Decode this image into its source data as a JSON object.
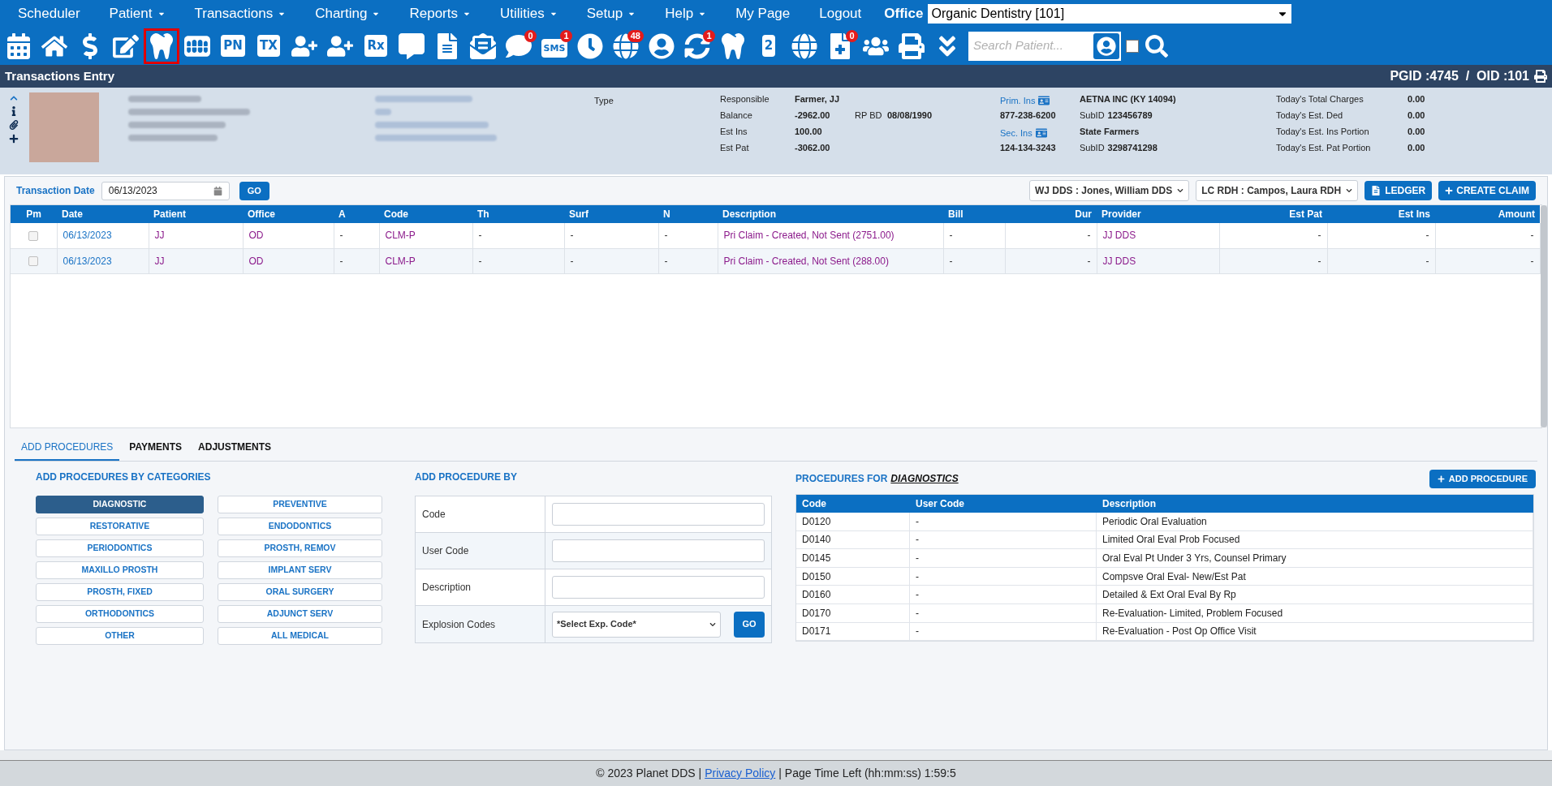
{
  "menu": {
    "items": [
      {
        "label": "Scheduler",
        "has_menu": false
      },
      {
        "label": "Patient",
        "has_menu": true
      },
      {
        "label": "Transactions",
        "has_menu": true
      },
      {
        "label": "Charting",
        "has_menu": true
      },
      {
        "label": "Reports",
        "has_menu": true
      },
      {
        "label": "Utilities",
        "has_menu": true
      },
      {
        "label": "Setup",
        "has_menu": true
      },
      {
        "label": "Help",
        "has_menu": true
      },
      {
        "label": "My Page",
        "has_menu": false
      },
      {
        "label": "Logout",
        "has_menu": false
      }
    ],
    "office_label": "Office",
    "office_value": "Organic Dentistry [101]"
  },
  "toolbar": {
    "items": [
      {
        "selected": false
      },
      {
        "selected": false
      },
      {
        "selected": false
      },
      {
        "selected": false
      },
      {
        "selected": true
      },
      {
        "selected": false
      },
      {
        "selected": false,
        "label": "PN"
      },
      {
        "selected": false,
        "label": "TX"
      },
      {
        "selected": false
      },
      {
        "selected": false
      },
      {
        "selected": false,
        "label": "Rx"
      },
      {
        "selected": false
      },
      {
        "selected": false
      },
      {
        "selected": false
      },
      {
        "selected": false,
        "badge": "0"
      },
      {
        "selected": false,
        "label": "SMS",
        "badge": "1"
      },
      {
        "selected": false
      },
      {
        "selected": false,
        "badge": "48"
      },
      {
        "selected": false
      },
      {
        "selected": false,
        "badge": "1"
      },
      {
        "selected": false
      },
      {
        "selected": false,
        "label": "2"
      },
      {
        "selected": false
      },
      {
        "selected": false,
        "badge": "0"
      },
      {
        "selected": false
      },
      {
        "selected": false
      },
      {
        "selected": false
      }
    ],
    "search_placeholder": "Search Patient...",
    "checkbox_checked": false
  },
  "title_bar": {
    "title": "Transactions Entry",
    "ids": "PGID :4745  /  OID :101"
  },
  "patient": {
    "type_label": "Type",
    "account": [
      {
        "label": "Responsible",
        "value": "Farmer, JJ"
      },
      {
        "label": "Balance",
        "value": "-2962.00"
      },
      {
        "label": "Est Ins",
        "value": "100.00"
      },
      {
        "label": "Est Pat",
        "value": "-3062.00"
      }
    ],
    "rp_bd": {
      "label": "RP BD",
      "value": "08/08/1990"
    },
    "insurance": [
      {
        "label": "Prim. Ins",
        "phone": "877-238-6200",
        "carrier": "AETNA INC (KY 14094)",
        "subid_label": "SubID",
        "subid": "123456789"
      },
      {
        "label": "Sec. Ins",
        "phone": "124-134-3243",
        "carrier": "State Farmers",
        "subid_label": "SubID",
        "subid": "3298741298"
      }
    ],
    "today": [
      {
        "label": "Today's Total Charges",
        "value": "0.00"
      },
      {
        "label": "Today's Est. Ded",
        "value": "0.00"
      },
      {
        "label": "Today's Est. Ins Portion",
        "value": "0.00"
      },
      {
        "label": "Today's Est. Pat Portion",
        "value": "0.00"
      }
    ]
  },
  "transactions": {
    "date_label": "Transaction Date",
    "date_value": "06/13/2023",
    "go": "GO",
    "providers": [
      "WJ DDS : Jones, William DDS",
      "LC RDH : Campos, Laura RDH"
    ],
    "ledger": "LEDGER",
    "create_claim": "CREATE CLAIM",
    "columns": [
      "Pm",
      "Date",
      "Patient",
      "Office",
      "A",
      "Code",
      "Th",
      "Surf",
      "N",
      "Description",
      "Bill",
      "Dur",
      "Provider",
      "Est Pat",
      "Est Ins",
      "Amount"
    ],
    "rows": [
      {
        "checked": false,
        "cells": [
          "",
          "06/13/2023",
          "JJ",
          "OD",
          "-",
          "CLM-P",
          "-",
          "-",
          "-",
          "Pri Claim - Created, Not Sent (2751.00)",
          "-",
          "-",
          "JJ DDS",
          "-",
          "-",
          "-"
        ]
      },
      {
        "checked": false,
        "cells": [
          "",
          "06/13/2023",
          "JJ",
          "OD",
          "-",
          "CLM-P",
          "-",
          "-",
          "-",
          "Pri Claim - Created, Not Sent (288.00)",
          "-",
          "-",
          "JJ DDS",
          "-",
          "-",
          "-"
        ]
      }
    ]
  },
  "tabs": [
    {
      "label": "ADD PROCEDURES",
      "selected": true
    },
    {
      "label": "PAYMENTS",
      "selected": false
    },
    {
      "label": "ADJUSTMENTS",
      "selected": false
    }
  ],
  "categories": {
    "title": "ADD PROCEDURES BY CATEGORIES",
    "items": [
      {
        "label": "DIAGNOSTIC",
        "selected": true
      },
      {
        "label": "PREVENTIVE",
        "selected": false
      },
      {
        "label": "RESTORATIVE",
        "selected": false
      },
      {
        "label": "ENDODONTICS",
        "selected": false
      },
      {
        "label": "PERIODONTICS",
        "selected": false
      },
      {
        "label": "PROSTH, REMOV",
        "selected": false
      },
      {
        "label": "MAXILLO PROSTH",
        "selected": false
      },
      {
        "label": "IMPLANT SERV",
        "selected": false
      },
      {
        "label": "PROSTH, FIXED",
        "selected": false
      },
      {
        "label": "ORAL SURGERY",
        "selected": false
      },
      {
        "label": "ORTHODONTICS",
        "selected": false
      },
      {
        "label": "ADJUNCT SERV",
        "selected": false
      },
      {
        "label": "OTHER",
        "selected": false
      },
      {
        "label": "ALL MEDICAL",
        "selected": false
      }
    ]
  },
  "add_by": {
    "title": "ADD PROCEDURE BY",
    "fields": [
      {
        "label": "Code",
        "kind": "text"
      },
      {
        "label": "User Code",
        "kind": "text"
      },
      {
        "label": "Description",
        "kind": "text"
      },
      {
        "label": "Explosion Codes",
        "kind": "select",
        "value": "*Select Exp. Code*",
        "button": "GO"
      }
    ]
  },
  "procedures": {
    "title": "PROCEDURES FOR",
    "category": "DIAGNOSTICS",
    "add_button": "ADD PROCEDURE",
    "columns": [
      "Code",
      "User Code",
      "Description"
    ],
    "rows": [
      [
        "D0120",
        "-",
        "Periodic Oral Evaluation"
      ],
      [
        "D0140",
        "-",
        "Limited Oral Eval Prob Focused"
      ],
      [
        "D0145",
        "-",
        "Oral Eval Pt Under 3 Yrs, Counsel Primary"
      ],
      [
        "D0150",
        "-",
        "Compsve Oral Eval- New/Est Pat"
      ],
      [
        "D0160",
        "-",
        "Detailed & Ext Oral Eval By Rp"
      ],
      [
        "D0170",
        "-",
        "Re-Evaluation- Limited, Problem Focused"
      ],
      [
        "D0171",
        "-",
        "Re-Evaluation - Post Op Office Visit"
      ]
    ]
  },
  "footer": {
    "copyright": "© 2023 Planet DDS |",
    "link": "Privacy Policy",
    "time": "| Page Time Left (hh:mm:ss) 1:59:5"
  }
}
